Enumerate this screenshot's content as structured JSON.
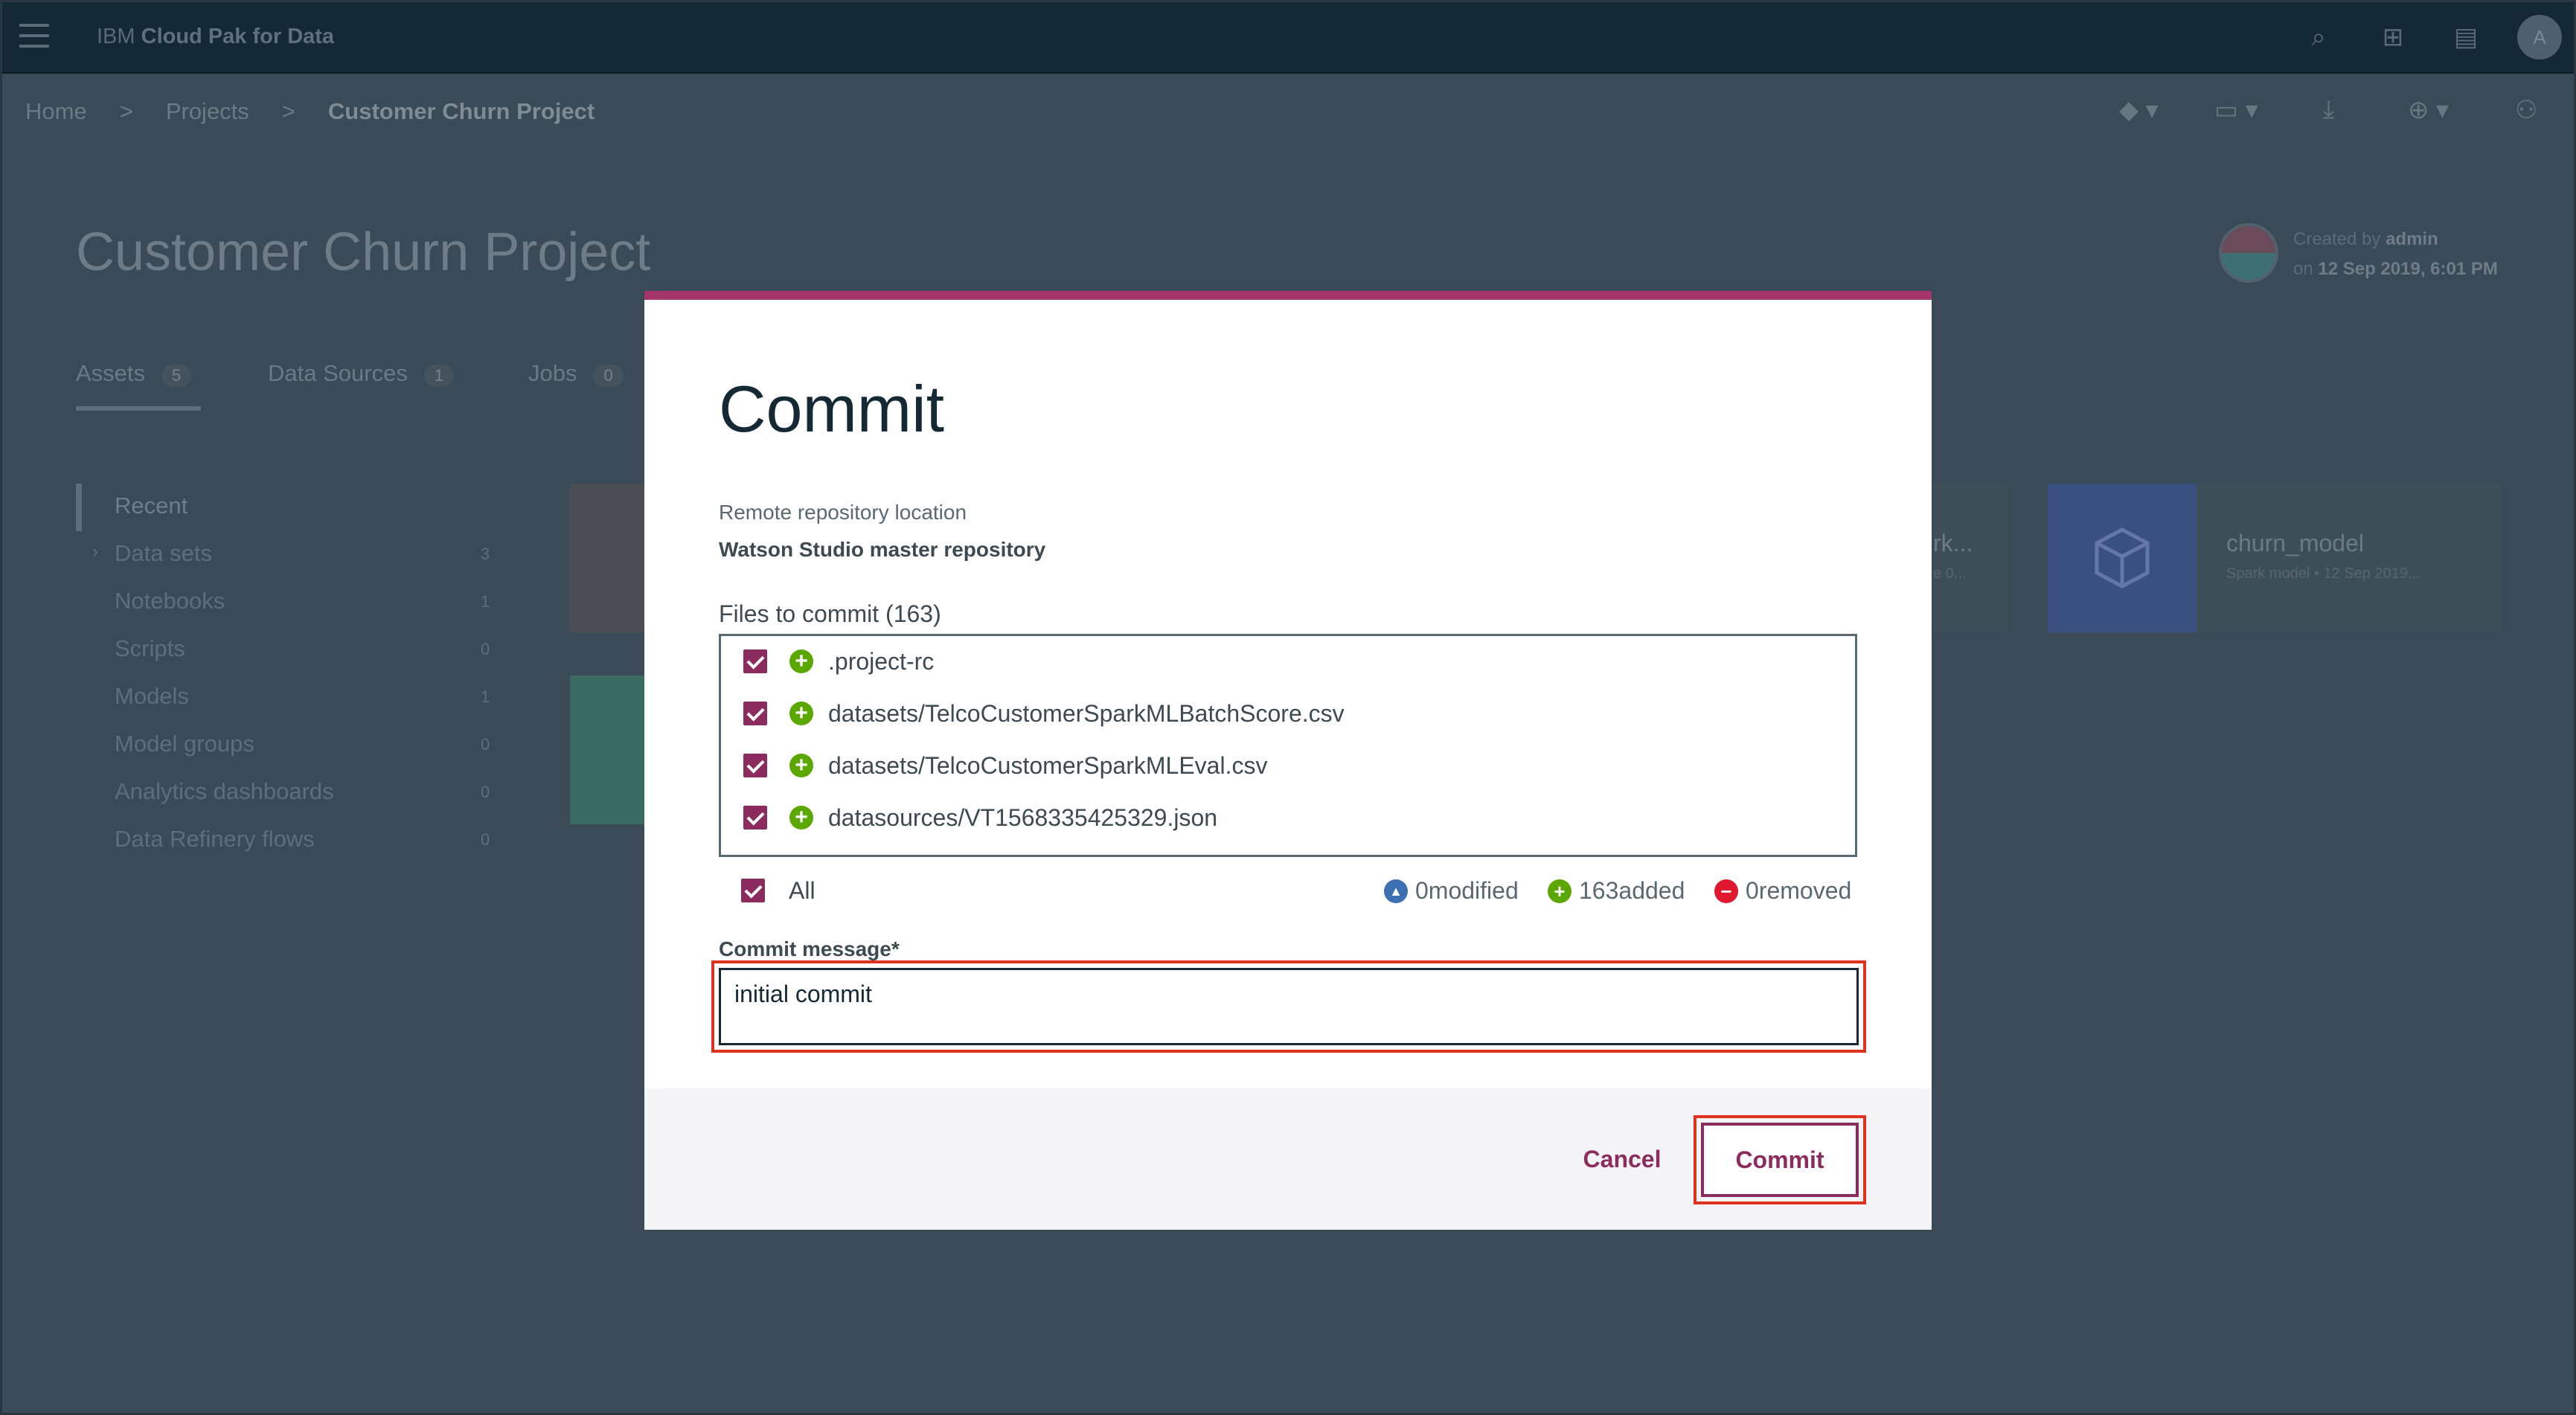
{
  "topbar": {
    "brand_prefix": "IBM",
    "brand_name": "Cloud Pak for Data",
    "avatar_initial": "A"
  },
  "breadcrumb": {
    "home": "Home",
    "projects": "Projects",
    "current": "Customer Churn Project",
    "separator": ">"
  },
  "project": {
    "title": "Customer Churn Project",
    "created_by_prefix": "Created by",
    "created_by": "admin",
    "created_on_prefix": "on",
    "created_on": "12 Sep 2019, 6:01 PM"
  },
  "tabs": [
    {
      "label": "Assets",
      "count": "5"
    },
    {
      "label": "Data Sources",
      "count": "1"
    },
    {
      "label": "Jobs",
      "count": "0"
    }
  ],
  "sidebar": {
    "items": [
      {
        "label": "Recent",
        "count": ""
      },
      {
        "label": "Data sets",
        "count": "3"
      },
      {
        "label": "Notebooks",
        "count": "1"
      },
      {
        "label": "Scripts",
        "count": "0"
      },
      {
        "label": "Models",
        "count": "1"
      },
      {
        "label": "Model groups",
        "count": "0"
      },
      {
        "label": "Analytics dashboards",
        "count": "0"
      },
      {
        "label": "Data Refinery flows",
        "count": "0"
      }
    ]
  },
  "cards": {
    "partial_title": "rk...",
    "partial_sub": "e 0...",
    "model_title": "churn_model",
    "model_sub": "Spark model • 12 Sep 2019..."
  },
  "modal": {
    "title": "Commit",
    "repo_label": "Remote repository location",
    "repo_name": "Watson Studio master repository",
    "files_label": "Files to commit (163)",
    "files": [
      {
        "name": ".project-rc",
        "checked": true,
        "status_icon": "plus-circle-icon"
      },
      {
        "name": "datasets/TelcoCustomerSparkMLBatchScore.csv",
        "checked": true,
        "status_icon": "plus-circle-icon"
      },
      {
        "name": "datasets/TelcoCustomerSparkMLEval.csv",
        "checked": true,
        "status_icon": "plus-circle-icon"
      },
      {
        "name": "datasources/VT1568335425329.json",
        "checked": true,
        "status_icon": "plus-circle-icon"
      }
    ],
    "all_label": "All",
    "stats": {
      "modified": "0modified",
      "added": "163added",
      "removed": "0removed"
    },
    "message_label": "Commit message*",
    "message_value": "initial commit",
    "cancel_label": "Cancel",
    "commit_label": "Commit"
  },
  "colors": {
    "accent": "#8c2c5e",
    "modal_top_bar": "#a4366b",
    "added_green": "#5aa700",
    "modified_blue": "#3d70b2",
    "removed_red": "#e0182d",
    "highlight_red": "#e0331f"
  }
}
